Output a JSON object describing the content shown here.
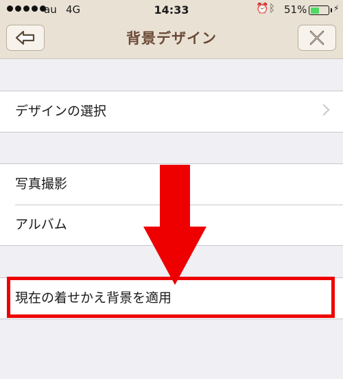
{
  "status_bar": {
    "carrier": "au",
    "network": "4G",
    "time": "14:33",
    "battery_percent": "51%",
    "battery_level": 0.51,
    "icons": [
      "signal-dots-icon",
      "alarm-icon",
      "bluetooth-icon",
      "battery-icon",
      "charging-icon"
    ]
  },
  "nav": {
    "title": "背景デザイン",
    "back_icon": "back-arrow-icon",
    "close_icon": "close-x-icon"
  },
  "sections": {
    "design": {
      "items": [
        {
          "label": "デザインの選択",
          "chevron": true
        }
      ]
    },
    "photo": {
      "items": [
        {
          "label": "写真撮影"
        },
        {
          "label": "アルバム"
        }
      ]
    },
    "apply": {
      "items": [
        {
          "label": "現在の着せかえ背景を適用"
        }
      ]
    }
  },
  "annotation": {
    "color": "#ee0000"
  }
}
